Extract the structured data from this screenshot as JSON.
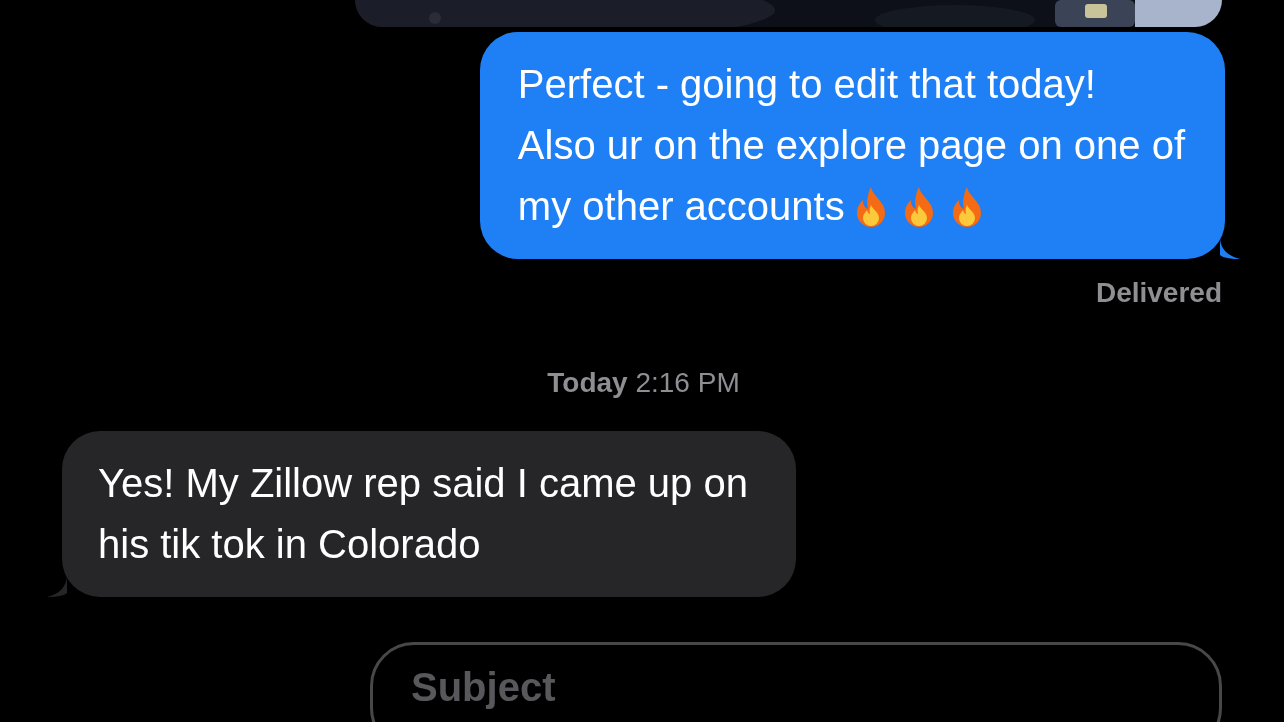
{
  "messages": [
    {
      "kind": "picture"
    },
    {
      "kind": "text",
      "outgoing": true,
      "lines": [
        "Perfect - going to edit that today!",
        "Also ur on the explore page on one of",
        "my other accounts"
      ],
      "emoji_icons": [
        {
          "kind": "fire"
        },
        {
          "kind": "fire"
        },
        {
          "kind": "fire"
        }
      ],
      "status": "Delivered"
    },
    {
      "kind": "timestamp",
      "day": "Today",
      "time": "2:16 PM"
    },
    {
      "kind": "text",
      "outgoing": false,
      "lines": [
        "Yes! My Zillow rep said I came up on",
        "his tik tok in Colorado"
      ]
    }
  ],
  "subject_field": {
    "placeholder": "Subject"
  }
}
